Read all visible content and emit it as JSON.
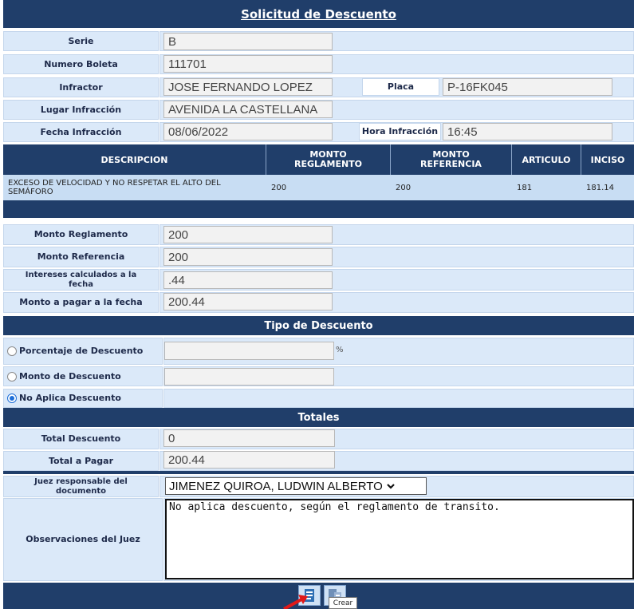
{
  "title": "Solicitud de Descuento",
  "fields": {
    "serie_label": "Serie",
    "serie_value": "B",
    "boleta_label": "Numero Boleta",
    "boleta_value": "111701",
    "infractor_label": "Infractor",
    "infractor_value": "JOSE FERNANDO LOPEZ",
    "placa_label": "Placa",
    "placa_value": "P-16FK045",
    "lugar_label": "Lugar Infracción",
    "lugar_value": "AVENIDA LA CASTELLANA",
    "fecha_label": "Fecha Infracción",
    "fecha_value": "08/06/2022",
    "hora_label": "Hora Infracción",
    "hora_value": "16:45"
  },
  "table": {
    "headers": [
      "DESCRIPCION",
      "MONTO REGLAMENTO",
      "MONTO REFERENCIA",
      "ARTICULO",
      "INCISO"
    ],
    "row": [
      "EXCESO DE VELOCIDAD Y NO RESPETAR EL ALTO DEL SEMÁFORO",
      "200",
      "200",
      "181",
      "181.14"
    ]
  },
  "montos": {
    "reglamento_label": "Monto Reglamento",
    "reglamento_value": "200",
    "referencia_label": "Monto Referencia",
    "referencia_value": "200",
    "intereses_label": "Intereses calculados a la fecha",
    "intereses_value": ".44",
    "pagar_label": "Monto a pagar a la fecha",
    "pagar_value": "200.44"
  },
  "tipo": {
    "header": "Tipo de Descuento",
    "porcentaje_label": "Porcentaje de Descuento",
    "percent_sign": "%",
    "monto_label": "Monto de Descuento",
    "no_aplica_label": "No Aplica Descuento",
    "selected": "No Aplica Descuento"
  },
  "totales": {
    "header": "Totales",
    "descuento_label": "Total Descuento",
    "descuento_value": "0",
    "pagar_label": "Total a Pagar",
    "pagar_value": "200.44"
  },
  "juez": {
    "label": "Juez responsable del documento",
    "selected": "JIMENEZ QUIROA, LUDWIN ALBERTO",
    "obs_label": "Observaciones del Juez",
    "obs_text": "No aplica descuento, según el reglamento de transito."
  },
  "toolbar": {
    "tooltip": "Crear",
    "create_icon": "create-document-icon",
    "edit_icon": "edit-document-icon"
  },
  "colors": {
    "header": "#203e6a",
    "label_bg": "#dbe9f9",
    "row_bg": "#c8ddf3",
    "radio": "#1e6fd9",
    "arrow": "#e01919"
  }
}
